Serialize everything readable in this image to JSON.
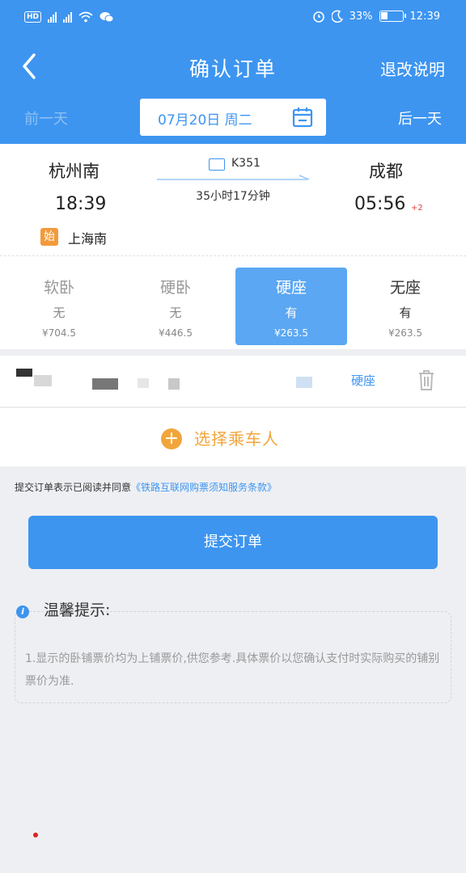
{
  "status_bar": {
    "hd": "HD",
    "net1": "2G",
    "net2": "4G",
    "battery": "33%",
    "battery_level": 0.33,
    "time": "12:39"
  },
  "header": {
    "title": "确认订单",
    "refund_rules": "退改说明"
  },
  "date_nav": {
    "prev": "前一天",
    "next": "后一天",
    "date": "07月20日  周二"
  },
  "train": {
    "from_station": "杭州南",
    "to_station": "成都",
    "train_no": "K351",
    "duration": "35小时17分钟",
    "dep_time": "18:39",
    "arr_time": "05:56",
    "arr_day_offset": "+2",
    "start_badge": "始",
    "start_station": "上海南"
  },
  "seats": [
    {
      "type": "软卧",
      "avail": "无",
      "price": "¥704.5"
    },
    {
      "type": "硬卧",
      "avail": "无",
      "price": "¥446.5"
    },
    {
      "type": "硬座",
      "avail": "有",
      "price": "¥263.5"
    },
    {
      "type": "无座",
      "avail": "有",
      "price": "¥263.5"
    }
  ],
  "passenger": {
    "seat_type": "硬座"
  },
  "add_passenger": {
    "label": "选择乘车人"
  },
  "agreement": {
    "prefix": "提交订单表示已阅读并同意",
    "link": "《铁路互联网购票须知服务条款》"
  },
  "submit": {
    "label": "提交订单"
  },
  "tips": {
    "title": "温馨提示:",
    "text": "1.显示的卧铺票价均为上铺票价,供您参考.具体票价以您确认支付时实际购买的铺别票价为准."
  },
  "colors": {
    "primary": "#3d95f0",
    "accent": "#f2a53a",
    "alert": "#e04040"
  }
}
